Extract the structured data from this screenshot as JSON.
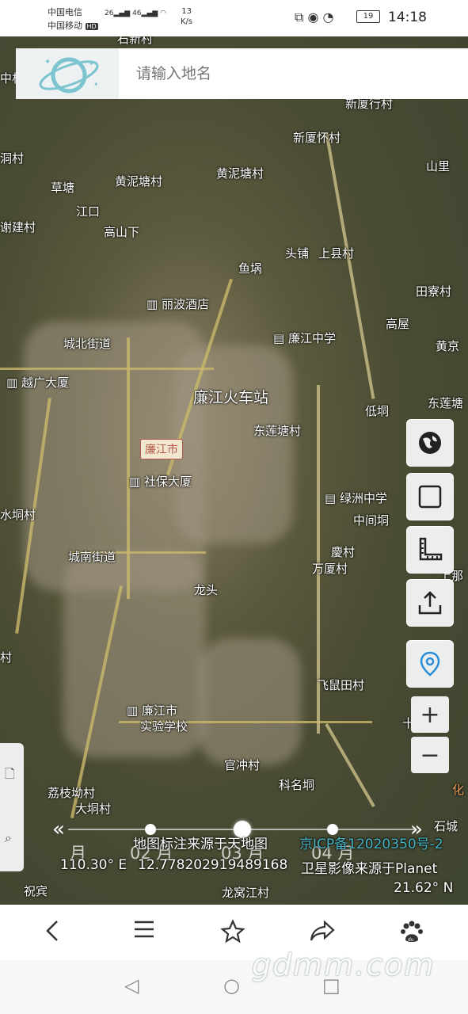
{
  "status_bar": {
    "carrier1": "中国电信",
    "carrier2": "中国移动",
    "hd_badge": "HD",
    "network1": "26",
    "network2": "46",
    "speed_value": "13",
    "speed_unit": "K/s",
    "battery": "19",
    "time": "14:18"
  },
  "search": {
    "placeholder": "请输入地名"
  },
  "map_labels": [
    "石新村",
    "新厦行村",
    "中村",
    "新厦怀村",
    "山里",
    "洞村",
    "黄泥塘村",
    "黄泥塘村",
    "草塘",
    "江口",
    "高山下",
    "谢建村",
    "头铺",
    "上县村",
    "鱼埚",
    "田寮村",
    "丽波酒店",
    "高屋",
    "黄京",
    "城北街道",
    "廉江中学",
    "越广大厦",
    "廉江火车站",
    "东莲塘",
    "低垌",
    "东莲塘村",
    "廉江市",
    "社保大厦",
    "绿洲中学",
    "水垌村",
    "中间垌",
    "城南街道",
    "慶村",
    "万厦村",
    "上那",
    "龙头",
    "村",
    "飞鼠田村",
    "廉江市",
    "实验学校",
    "十字路",
    "官冲村",
    "科名垌",
    "荔枝坳村",
    "化",
    "大垌村",
    "祝宾",
    "龙窝江村",
    "石城"
  ],
  "timeline": {
    "months": [
      "月",
      "02 月",
      "03 月",
      "04 月"
    ]
  },
  "credits": {
    "annotation": "地图标注来源于天地图",
    "icp": "京ICP备12020350号-2",
    "longitude": "110.30° E",
    "value": "12.778202919489168",
    "imagery": "卫星影像来源于Planet",
    "latitude": "21.62° N"
  },
  "controls": {
    "zoom_in": "+",
    "zoom_out": "−"
  },
  "watermark": "gdmm.com"
}
